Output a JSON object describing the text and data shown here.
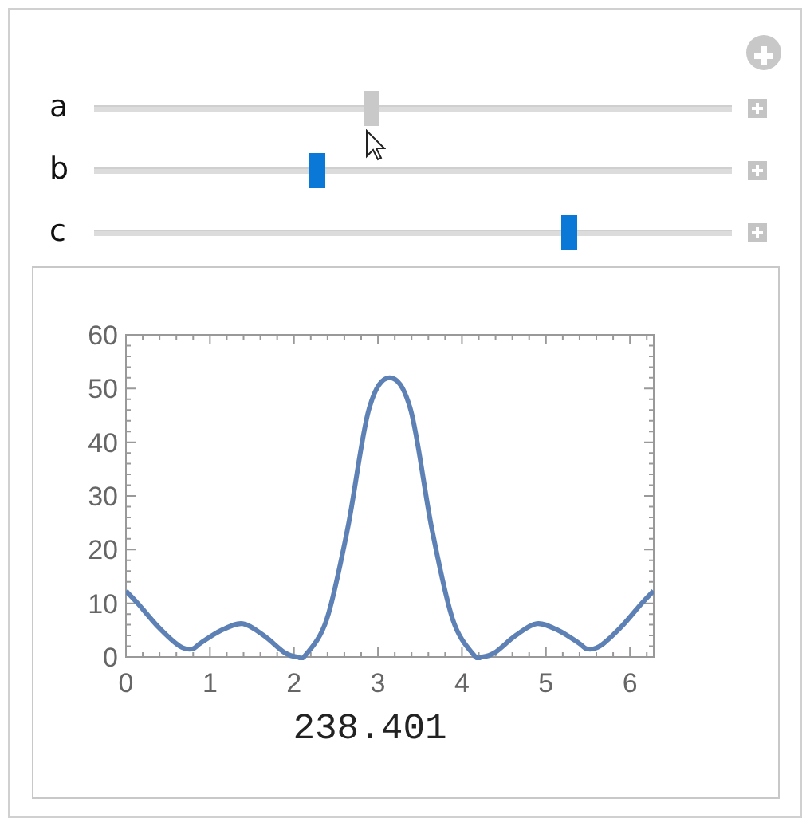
{
  "controls": [
    {
      "label": "a",
      "level": 0.435,
      "hovered": true
    },
    {
      "label": "b",
      "level": 0.35,
      "hovered": false
    },
    {
      "label": "c",
      "level": 0.745,
      "hovered": false
    }
  ],
  "output": {
    "chart_data": {
      "type": "line",
      "xlim": [
        0,
        6.2832
      ],
      "ylim": [
        0,
        60
      ],
      "xticks": [
        0,
        1,
        2,
        3,
        4,
        5,
        6
      ],
      "yticks": [
        0,
        10,
        20,
        30,
        40,
        50,
        60
      ],
      "x": [
        0,
        0.14,
        0.39,
        0.64,
        0.79,
        0.89,
        1.14,
        1.39,
        1.64,
        1.89,
        2.04,
        2.14,
        2.39,
        2.64,
        2.89,
        3.14,
        3.39,
        3.64,
        3.89,
        4.14,
        4.24,
        4.39,
        4.64,
        4.89,
        5.14,
        5.39,
        5.49,
        5.64,
        5.89,
        6.14,
        6.28
      ],
      "series": [
        {
          "color": "#5e81b5",
          "values": [
            12.3,
            10,
            5.5,
            2,
            1.5,
            2.6,
            5,
            6.2,
            4,
            0.8,
            0,
            0.4,
            7,
            24,
            46,
            52,
            46,
            24,
            7,
            0.4,
            0,
            0.8,
            4,
            6.2,
            5,
            2.6,
            1.5,
            2,
            5.5,
            10,
            12.3
          ]
        }
      ]
    },
    "value": "238.401"
  }
}
